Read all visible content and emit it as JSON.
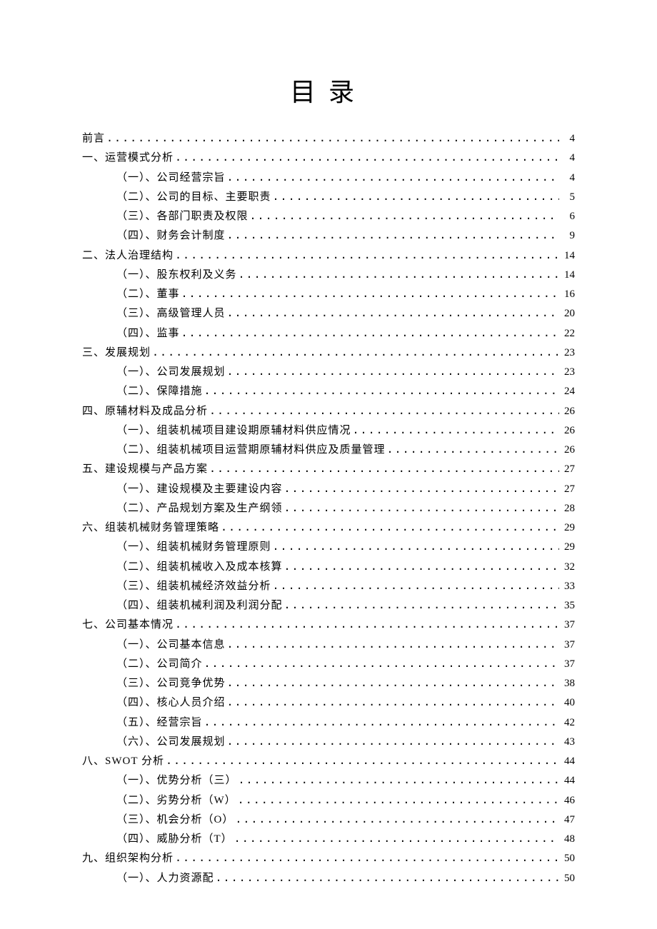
{
  "title": "目录",
  "entries": [
    {
      "level": 1,
      "label": "前言",
      "page": "4"
    },
    {
      "level": 1,
      "label": "一、运营模式分析",
      "page": "4"
    },
    {
      "level": 2,
      "label": "（一）、公司经营宗旨",
      "page": "4"
    },
    {
      "level": 2,
      "label": "（二）、公司的目标、主要职责",
      "page": "5"
    },
    {
      "level": 2,
      "label": "（三）、各部门职责及权限",
      "page": "6"
    },
    {
      "level": 2,
      "label": "（四）、财务会计制度",
      "page": "9"
    },
    {
      "level": 1,
      "label": "二、法人治理结构",
      "page": "14"
    },
    {
      "level": 2,
      "label": "（一）、股东权利及义务",
      "page": "14"
    },
    {
      "level": 2,
      "label": "（二）、董事",
      "page": "16"
    },
    {
      "level": 2,
      "label": "（三）、高级管理人员",
      "page": "20"
    },
    {
      "level": 2,
      "label": "（四）、监事",
      "page": "22"
    },
    {
      "level": 1,
      "label": "三、发展规划",
      "page": "23"
    },
    {
      "level": 2,
      "label": "（一）、公司发展规划",
      "page": "23"
    },
    {
      "level": 2,
      "label": "（二）、保障措施",
      "page": "24"
    },
    {
      "level": 1,
      "label": "四、原辅材料及成品分析",
      "page": "26"
    },
    {
      "level": 2,
      "label": "（一）、组装机械项目建设期原辅材料供应情况",
      "page": "26"
    },
    {
      "level": 2,
      "label": "（二）、组装机械项目运营期原辅材料供应及质量管理",
      "page": "26"
    },
    {
      "level": 1,
      "label": "五、建设规模与产品方案",
      "page": "27"
    },
    {
      "level": 2,
      "label": "（一）、建设规模及主要建设内容",
      "page": "27"
    },
    {
      "level": 2,
      "label": "（二）、产品规划方案及生产纲领",
      "page": "28"
    },
    {
      "level": 1,
      "label": "六、组装机械财务管理策略",
      "page": "29"
    },
    {
      "level": 2,
      "label": "（一）、组装机械财务管理原则",
      "page": "29"
    },
    {
      "level": 2,
      "label": "（二）、组装机械收入及成本核算",
      "page": "32"
    },
    {
      "level": 2,
      "label": "（三）、组装机械经济效益分析",
      "page": "33"
    },
    {
      "level": 2,
      "label": "（四）、组装机械利润及利润分配",
      "page": "35"
    },
    {
      "level": 1,
      "label": "七、公司基本情况",
      "page": "37"
    },
    {
      "level": 2,
      "label": "（一）、公司基本信息",
      "page": "37"
    },
    {
      "level": 2,
      "label": "（二）、公司简介",
      "page": "37"
    },
    {
      "level": 2,
      "label": "（三）、公司竞争优势",
      "page": "38"
    },
    {
      "level": 2,
      "label": "（四）、核心人员介绍",
      "page": "40"
    },
    {
      "level": 2,
      "label": "（五）、经营宗旨",
      "page": "42"
    },
    {
      "level": 2,
      "label": "（六）、公司发展规划",
      "page": "43"
    },
    {
      "level": 1,
      "label": "八、SWOT 分析",
      "page": "44"
    },
    {
      "level": 2,
      "label": "（一）、优势分析（三）",
      "page": "44"
    },
    {
      "level": 2,
      "label": "（二）、劣势分析（W）",
      "page": "46"
    },
    {
      "level": 2,
      "label": "（三）、机会分析（O）",
      "page": "47"
    },
    {
      "level": 2,
      "label": "（四）、威胁分析（T）",
      "page": "48"
    },
    {
      "level": 1,
      "label": "九、组织架构分析",
      "page": "50"
    },
    {
      "level": 2,
      "label": "（一）、人力资源配",
      "page": "50"
    }
  ]
}
